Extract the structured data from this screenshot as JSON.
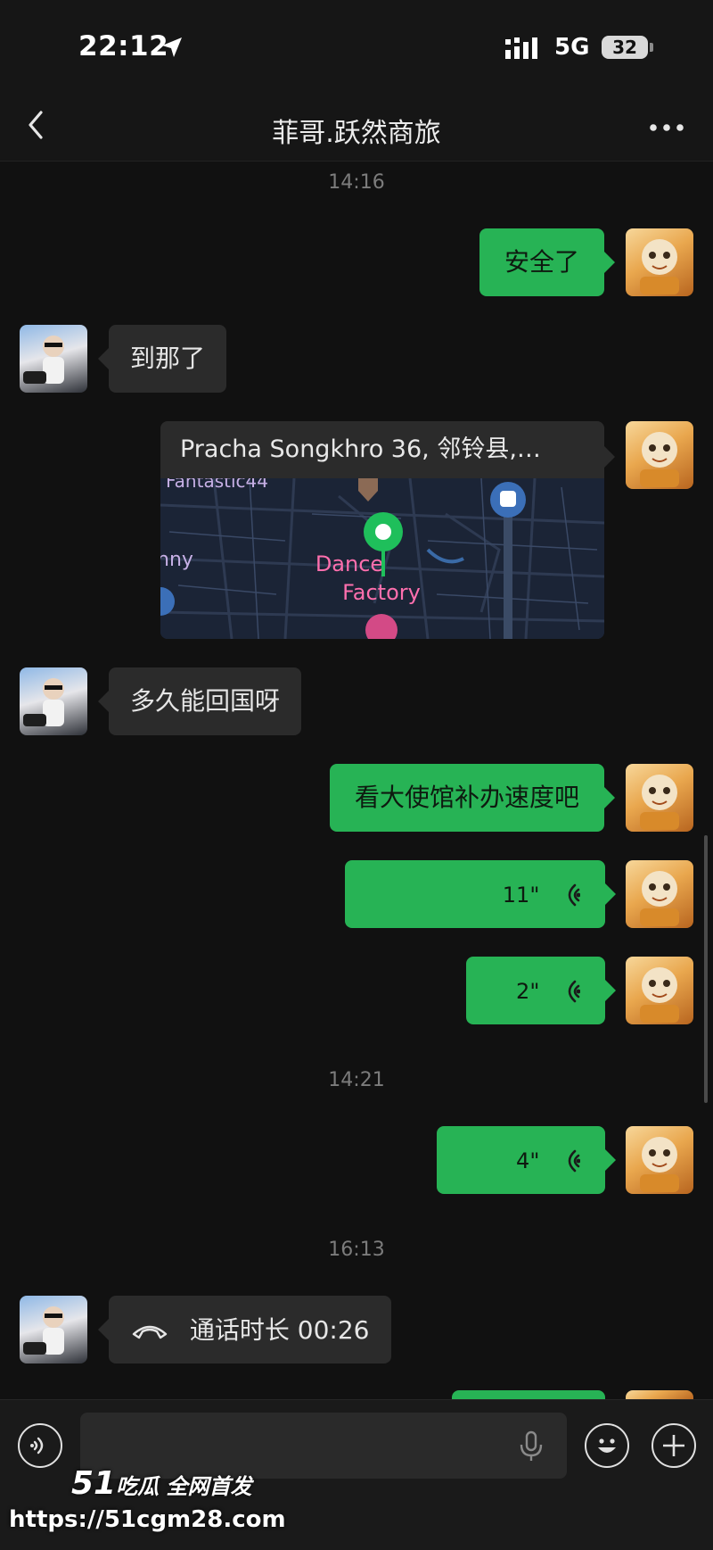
{
  "status_bar": {
    "time": "22:12",
    "network": "5G",
    "battery": "32"
  },
  "header": {
    "title": "菲哥.跃然商旅",
    "back_icon": "chevron-left-icon",
    "more_icon": "ellipsis-icon"
  },
  "timestamps": [
    "14:16",
    "14:21",
    "16:13"
  ],
  "messages": {
    "m1": {
      "text": "安全了"
    },
    "m2": {
      "text": "到那了"
    },
    "m3": {
      "address": "Pracha Songkhro 36, 邻铃县,…",
      "map_labels": [
        "Fantastic44",
        "nny",
        "Dance",
        "Factory"
      ]
    },
    "m4": {
      "text": "多久能回国呀"
    },
    "m5": {
      "text": "看大使馆补办速度吧"
    },
    "m6": {
      "duration": "11\""
    },
    "m7": {
      "duration": "2\""
    },
    "m8": {
      "duration": "4\""
    },
    "m9": {
      "text": "通话时长 00:26"
    }
  },
  "input_bar": {
    "placeholder": "",
    "voice_icon": "voice-mode-icon",
    "mic_icon": "microphone-icon",
    "emoji_icon": "emoji-icon",
    "plus_icon": "plus-icon"
  },
  "watermark": {
    "brand": "51",
    "slogan": "吃瓜 全网首发",
    "url": "https://51cgm28.com"
  },
  "colors": {
    "background": "#111111",
    "my_bubble": "#27b355",
    "their_bubble": "#2b2b2b",
    "map_pin": "#1fbf5b"
  }
}
